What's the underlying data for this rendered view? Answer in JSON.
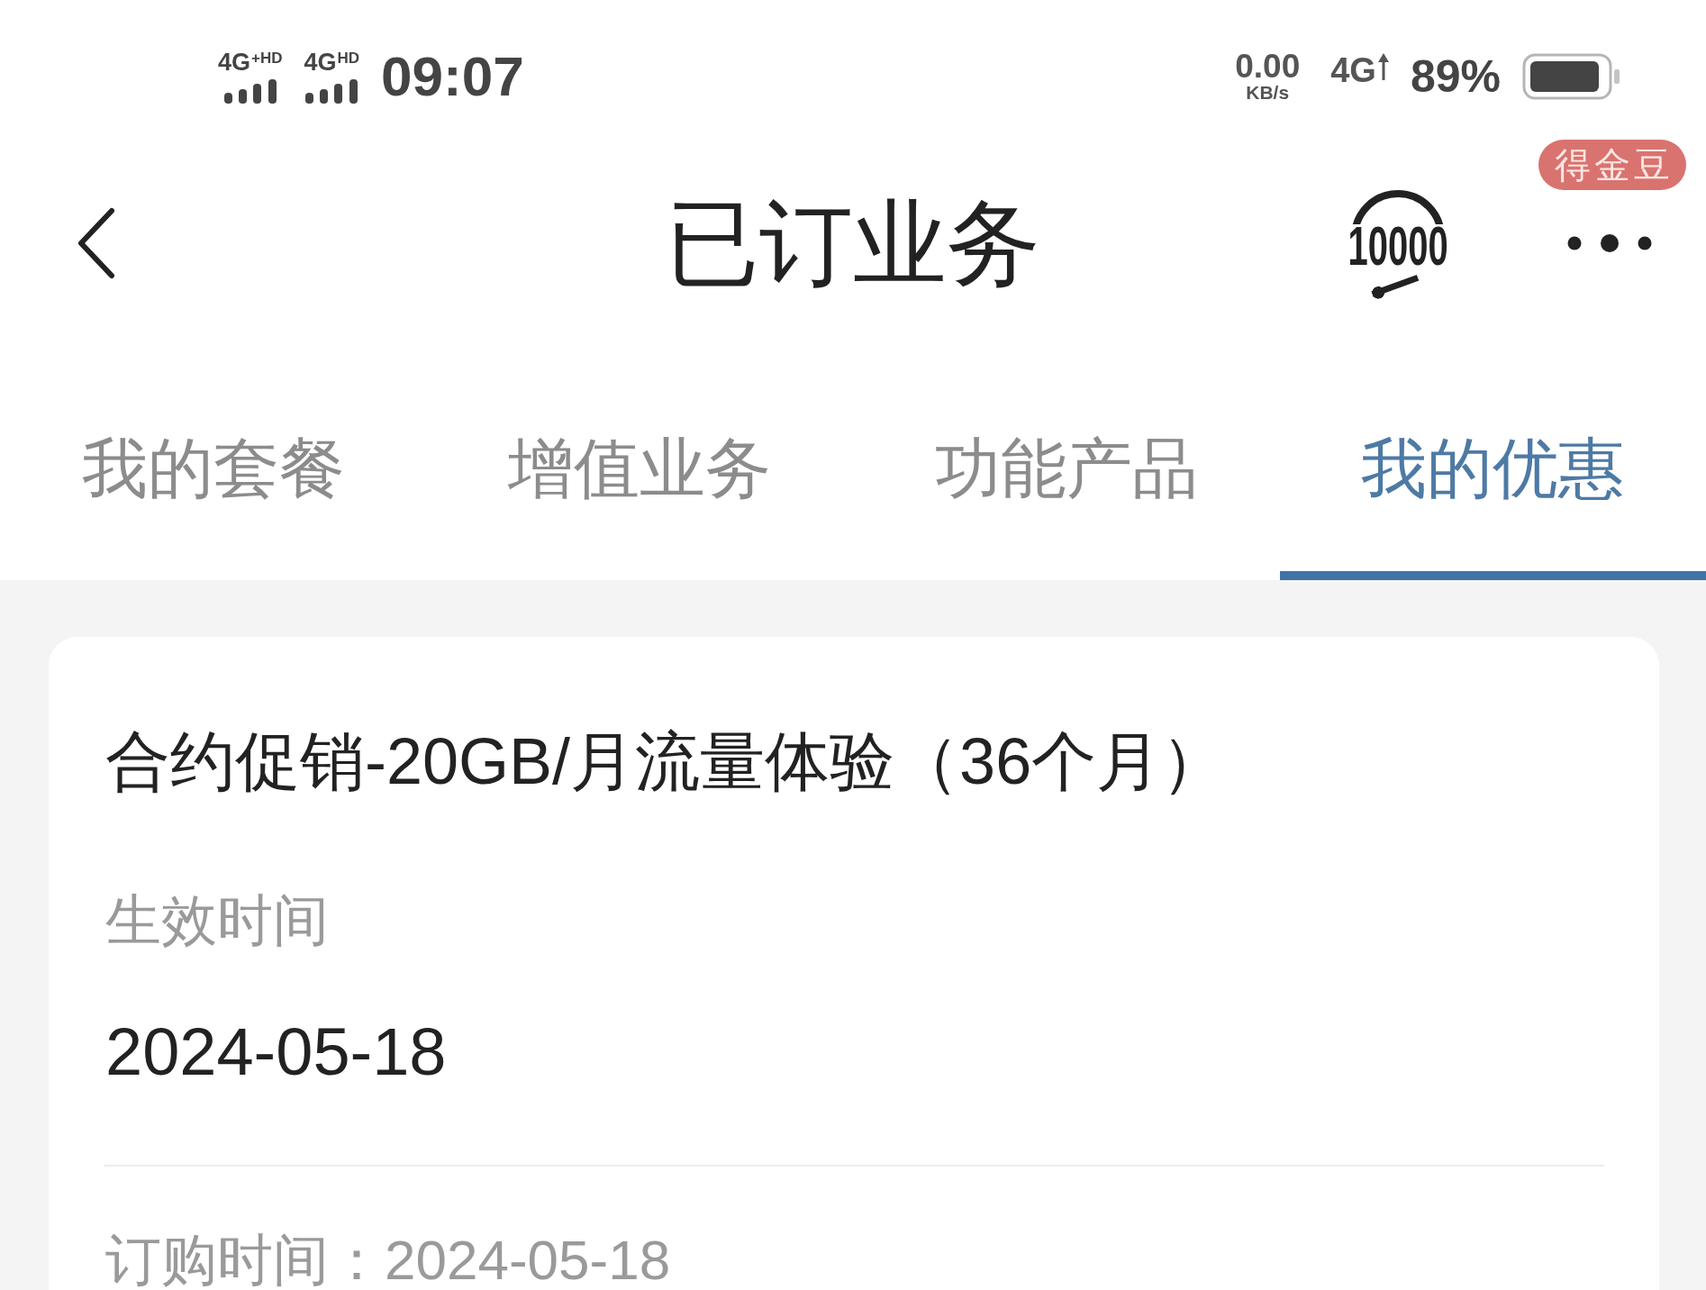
{
  "status_bar": {
    "signals": [
      {
        "label": "4G$^{+HD}$"
      },
      {
        "label": "4G$^{HD}$"
      }
    ],
    "time": "09:07",
    "speed": {
      "value": "0.00",
      "unit": "KB/s"
    },
    "network": "4G",
    "battery": "89%"
  },
  "header": {
    "title": "已订业务",
    "service_logo": "10000",
    "badge": "得金豆"
  },
  "tabs": [
    {
      "label": "我的套餐",
      "selected": false
    },
    {
      "label": "增值业务",
      "selected": false
    },
    {
      "label": "功能产品",
      "selected": false
    },
    {
      "label": "我的优惠",
      "selected": true
    }
  ],
  "card": {
    "title": "合约促销-20GB/月流量体验（36个月）",
    "effective_time": {
      "label": "生效时间",
      "value": "2024-05-18"
    },
    "order_time": "订购时间：2024-05-18"
  }
}
